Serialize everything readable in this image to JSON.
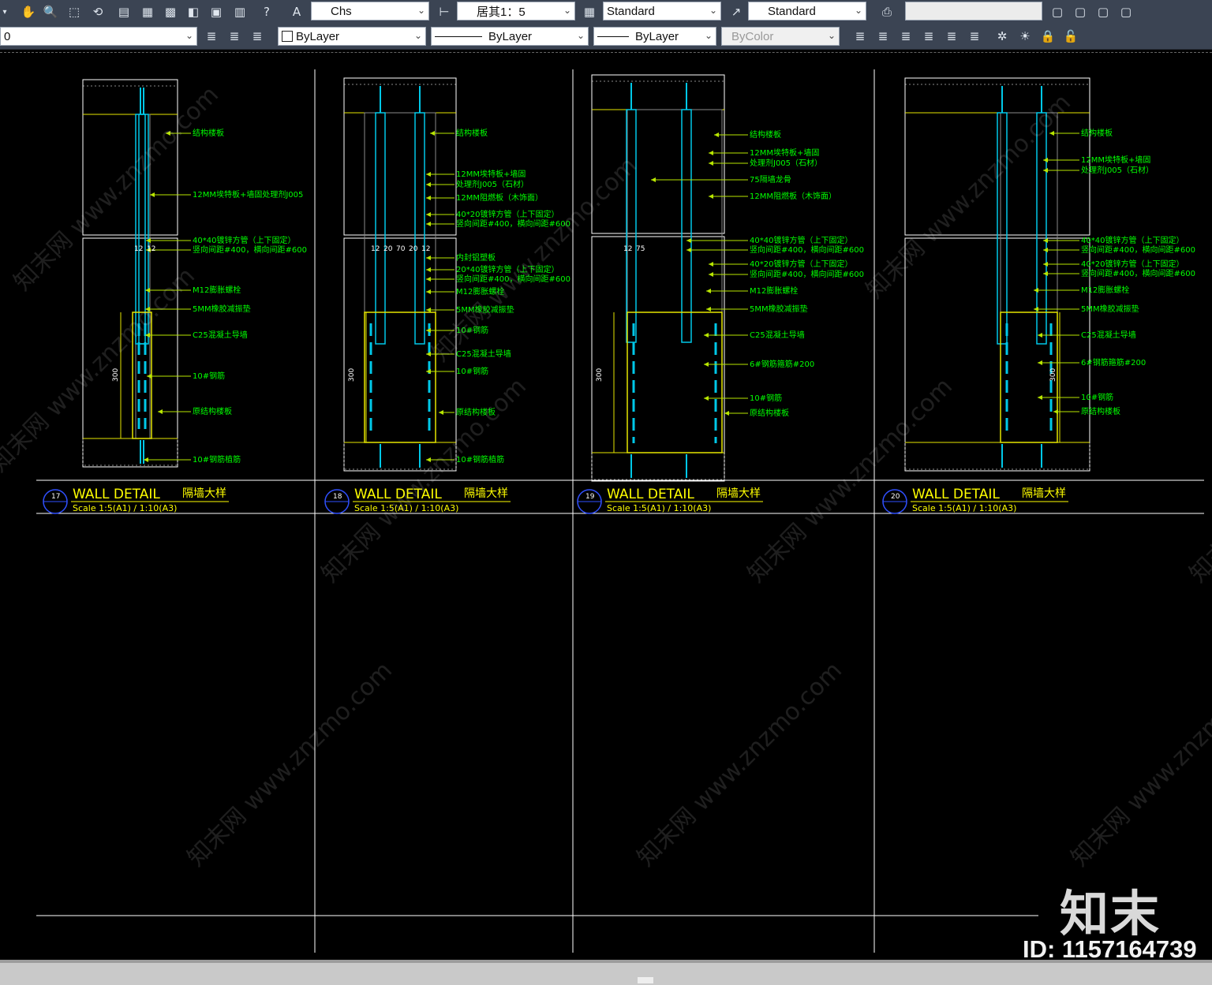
{
  "toolbar_top": {
    "icons": [
      "pan-icon",
      "zoom-realtime-icon",
      "zoom-window-icon",
      "zoom-previous-icon",
      "properties-icon",
      "design-center-icon",
      "tool-palettes-icon",
      "sheet-set-icon",
      "markup-icon",
      "calculator-icon",
      "help-icon",
      "text-style-icon",
      "dim-style-icon",
      "table-style-icon",
      "multileader-style-icon",
      "plot-icon",
      "viewport-1-icon",
      "viewport-2-icon",
      "viewport-3-icon",
      "viewport-4-icon"
    ],
    "text_style": "Chs",
    "dim_style": "居其1：5",
    "table_style": "Standard",
    "mleader_style": "Standard",
    "blank_field": ""
  },
  "toolbar_layers": {
    "layer": "0",
    "color": "ByLayer",
    "linetype": "ByLayer",
    "lineweight": "ByLayer",
    "plotstyle": "ByColor",
    "layer_icons": [
      "layer-properties-icon",
      "layer-state-icon",
      "layer-previous-icon",
      "match-layer-icon",
      "change-current-icon",
      "copy-objects-icon",
      "layer-walk-icon",
      "isolate-icon",
      "unisolate-icon",
      "freeze-icon",
      "off-icon",
      "lock-icon",
      "unlock-icon"
    ]
  },
  "drawing": {
    "details": [
      {
        "number": "17",
        "title": "WALL  DETAIL",
        "title_cn": "隔墙大样",
        "scale": "Scale  1:5(A1)  /  1:10(A3)",
        "dims": [
          "12",
          "12",
          "300"
        ],
        "labels": [
          "结构楼板",
          "12MM埃特板+墙固处理剂J005",
          "40*40镀锌方管（上下固定）",
          "竖向间距#400，横向间距#600",
          "M12膨胀螺栓",
          "5MM橡胶减振垫",
          "C25混凝土导墙",
          "10#钢筋",
          "原结构楼板",
          "10#钢筋植筋"
        ]
      },
      {
        "number": "18",
        "title": "WALL  DETAIL",
        "title_cn": "隔墙大样",
        "scale": "Scale  1:5(A1)  /  1:10(A3)",
        "dims": [
          "12",
          "20",
          "70",
          "20",
          "12",
          "300"
        ],
        "labels": [
          "结构楼板",
          "12MM埃特板+墙固",
          "处理剂J005（石材）",
          "12MM阻燃板（木饰面）",
          "40*20镀锌方管（上下固定）",
          "竖向间距#400，横向间距#600",
          "内封铝塑板",
          "20*40镀锌方管（上下固定）",
          "竖向间距#400，横向间距#600",
          "M12膨胀螺栓",
          "5MM橡胶减振垫",
          "10#钢筋",
          "C25混凝土导墙",
          "10#钢筋",
          "原结构楼板",
          "10#钢筋植筋"
        ]
      },
      {
        "number": "19",
        "title": "WALL  DETAIL",
        "title_cn": "隔墙大样",
        "scale": "Scale  1:5(A1)  /  1:10(A3)",
        "dims": [
          "12",
          "75",
          "300"
        ],
        "labels": [
          "结构楼板",
          "12MM埃特板+墙固",
          "处理剂J005（石材）",
          "75隔墙龙骨",
          "12MM阻燃板（木饰面）",
          "40*40镀锌方管（上下固定）",
          "竖向间距#400，横向间距#600",
          "40*20镀锌方管（上下固定）",
          "竖向间距#400，横向间距#600",
          "M12膨胀螺栓",
          "5MM橡胶减振垫",
          "C25混凝土导墙",
          "6#钢筋箍筋#200",
          "10#钢筋",
          "原结构楼板"
        ]
      },
      {
        "number": "20",
        "title": "WALL  DETAIL",
        "title_cn": "隔墙大样",
        "scale": "Scale  1:5(A1)  /  1:10(A3)",
        "dims": [
          "300"
        ],
        "labels": [
          "结构楼板",
          "12MM埃特板+墙固",
          "处理剂J005（石材）",
          "40*40镀锌方管（上下固定）",
          "竖向间距#400，横向间距#600",
          "40*20镀锌方管（上下固定）",
          "竖向间距#400，横向间距#600",
          "M12膨胀螺栓",
          "5MM橡胶减振垫",
          "C25混凝土导墙",
          "6#钢筋箍筋#200",
          "10#钢筋",
          "原结构楼板"
        ]
      }
    ],
    "watermark": "知末网 www.znzmo.com",
    "colors": {
      "outline": "#ffffff",
      "steel": "#00c8e8",
      "label": "#00ff00",
      "leader": "#b8e600",
      "dim": "#e6e600",
      "title": "#ffff00",
      "circle": "#3050ff",
      "concrete": "#8a8a8a"
    }
  },
  "brand": "知末",
  "id_label": "ID: 1157164739"
}
